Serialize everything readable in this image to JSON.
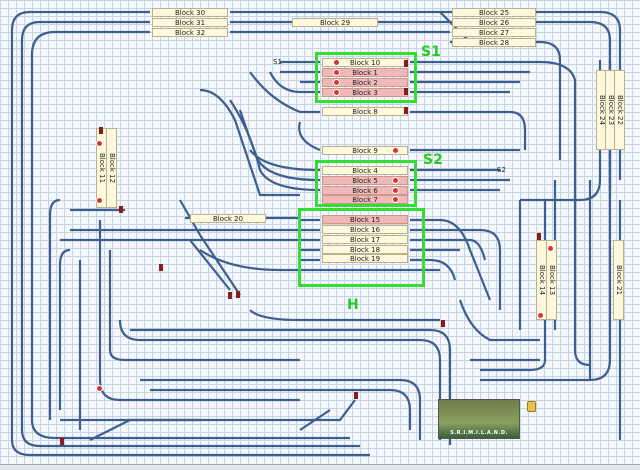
{
  "blocks": {
    "b30": "Block 30",
    "b31": "Block 31",
    "b32": "Block 32",
    "b29": "Block 29",
    "b25": "Block 25",
    "b26": "Block 26",
    "b27": "Block 27",
    "b28": "Block 28",
    "b10": "Block 10",
    "b1": "Block 1",
    "b2": "Block 2",
    "b3": "Block 3",
    "b8": "Block 8",
    "b9": "Block 9",
    "b4": "Block 4",
    "b5": "Block 5",
    "b6": "Block 6",
    "b7": "Block 7",
    "b15": "Block 15",
    "b16": "Block 16",
    "b17": "Block 17",
    "b18": "Block 18",
    "b19": "Block 19",
    "b20": "Block 20",
    "b11": "Block 11",
    "b12": "Block 12",
    "b22": "Block 22",
    "b23": "Block 23",
    "b24": "Block 24",
    "b13": "Block 13",
    "b14": "Block 14",
    "b21": "Block 21"
  },
  "frames": {
    "s1": "S1",
    "s2": "S2",
    "h": "H"
  },
  "signals": {
    "s1": "S1",
    "s2": "S2"
  },
  "logo_text": "S.R.I.M.I.L.A.N.D.",
  "colors": {
    "track": "#3d5f8f",
    "frame": "#33dd33",
    "occupied": "#f0b8b8"
  }
}
